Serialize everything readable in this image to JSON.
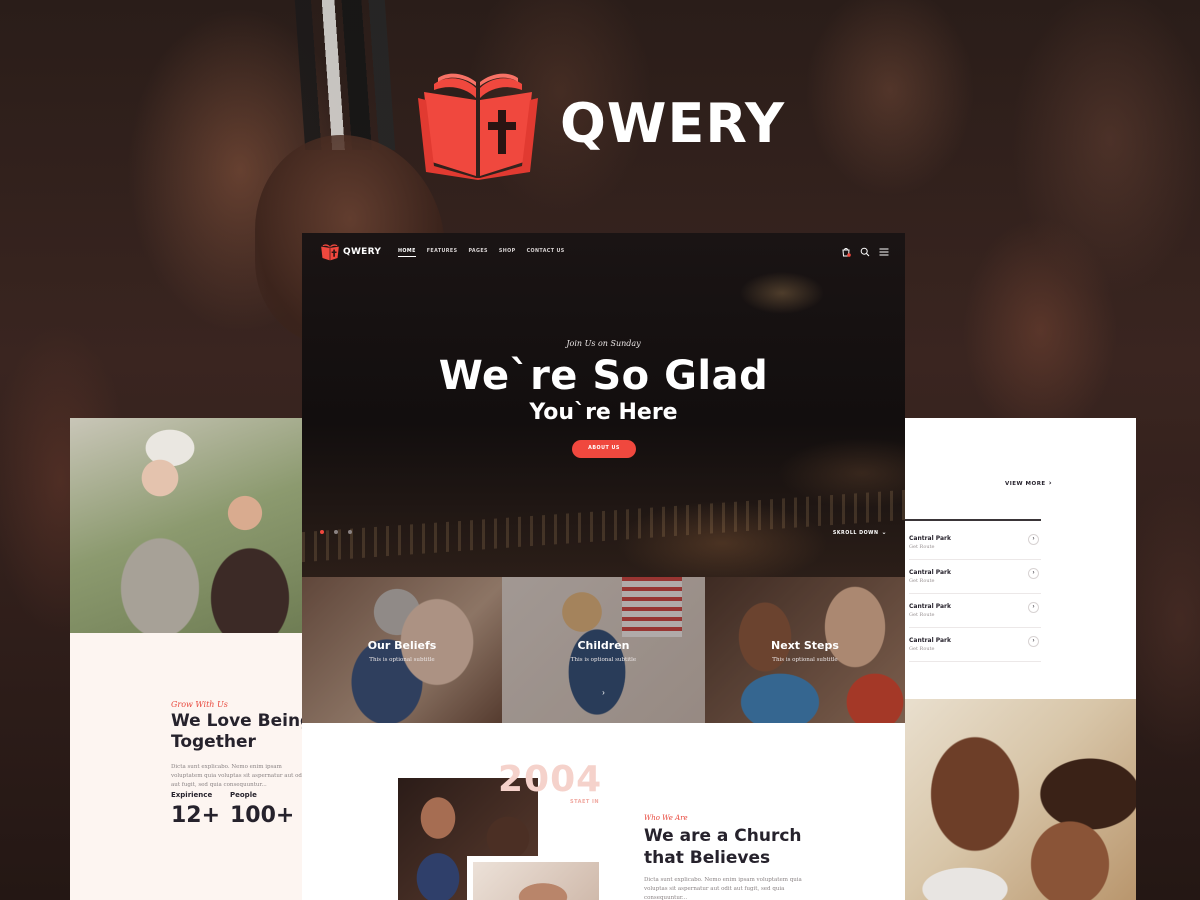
{
  "brand": {
    "name": "QWERY",
    "accent_color": "#f0483e",
    "logo_icon": "open-book-cross-icon"
  },
  "header": {
    "nav": [
      "HOME",
      "FEATURES",
      "PAGES",
      "SHOP",
      "CONTACT US"
    ],
    "active_nav": "HOME",
    "icons": [
      "cart-icon",
      "search-icon",
      "menu-icon"
    ]
  },
  "hero": {
    "kicker": "Join Us on Sunday",
    "title": "We`re So Glad",
    "subtitle": "You`re Here",
    "button_label": "ABOUT US",
    "scroll_label": "SKROLL DOWN",
    "slides": 3,
    "active_slide": 1
  },
  "features": [
    {
      "title": "Our Beliefs",
      "subtitle": "This is optional subtitle"
    },
    {
      "title": "Children",
      "subtitle": "This is optional subtitle"
    },
    {
      "title": "Next Steps",
      "subtitle": "This is optional subtitle"
    }
  ],
  "about": {
    "year": "2004",
    "year_label": "STAET IN",
    "kicker": "Who We Are",
    "title": "We are a Church\nthat Believes",
    "text": "Dicta sunt explicabo. Nemo enim ipsam voluptatem quia voluptas sit aspernatur aut odit aut fugit, sed quia consequuntur..."
  },
  "left_panel": {
    "kicker": "Grow With Us",
    "title": "We Love Being\nTogether",
    "text": "Dicta sunt explicabo. Nemo enim ipsam voluptatem quia voluptas sit aspernatur aut odit aut fugit, sed quia consequuntur...",
    "stats": [
      {
        "label": "Expirience",
        "value": "12+"
      },
      {
        "label": "People",
        "value": "100+"
      }
    ]
  },
  "right_panel": {
    "view_more": "VIEW MORE",
    "events": [
      {
        "title": "Cantral Park",
        "subtitle": "Get Route"
      },
      {
        "title": "Cantral Park",
        "subtitle": "Get Route"
      },
      {
        "title": "Cantral Park",
        "subtitle": "Get Route"
      },
      {
        "title": "Cantral Park",
        "subtitle": "Get Route"
      }
    ]
  }
}
